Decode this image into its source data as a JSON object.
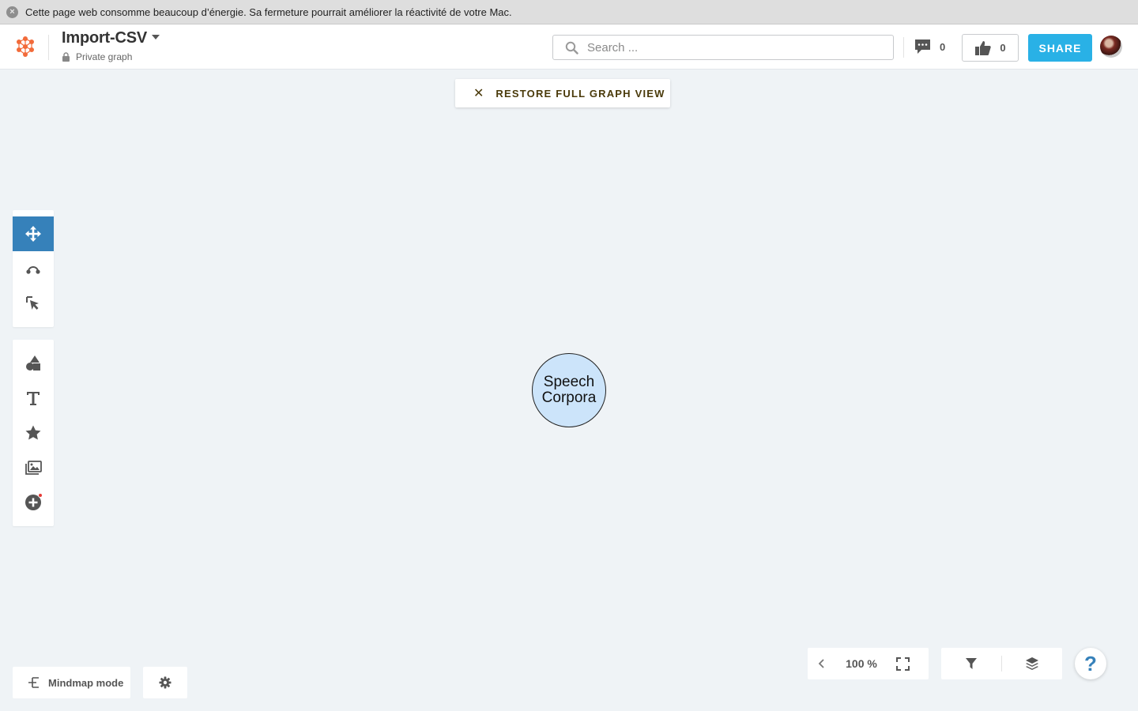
{
  "notice": {
    "text": "Cette page web consomme beaucoup d’énergie. Sa fermeture pourrait améliorer la réactivité de votre Mac.",
    "close_icon": "close-icon"
  },
  "header": {
    "title": "Import-CSV",
    "privacy": "Private graph",
    "search": {
      "placeholder": "Search ...",
      "value": ""
    },
    "comments_count": "0",
    "likes_count": "0",
    "share_label": "SHARE",
    "accent_color": "#29b1e6"
  },
  "banner": {
    "label": "RESTORE FULL GRAPH VIEW"
  },
  "toolbar": {
    "navigation_tools": [
      "move-tool",
      "connect-tool",
      "select-tool"
    ],
    "insert_tools": [
      "shapes-tool",
      "text-tool",
      "icon-tool",
      "image-tool",
      "add-element-tool"
    ],
    "active_color": "#3681ba"
  },
  "graph": {
    "nodes": [
      {
        "label": "Speech Corpora",
        "fill": "#cce4fa"
      }
    ]
  },
  "bottom": {
    "mindmap_label": "Mindmap mode",
    "zoom": "100 %",
    "help_label": "?"
  }
}
